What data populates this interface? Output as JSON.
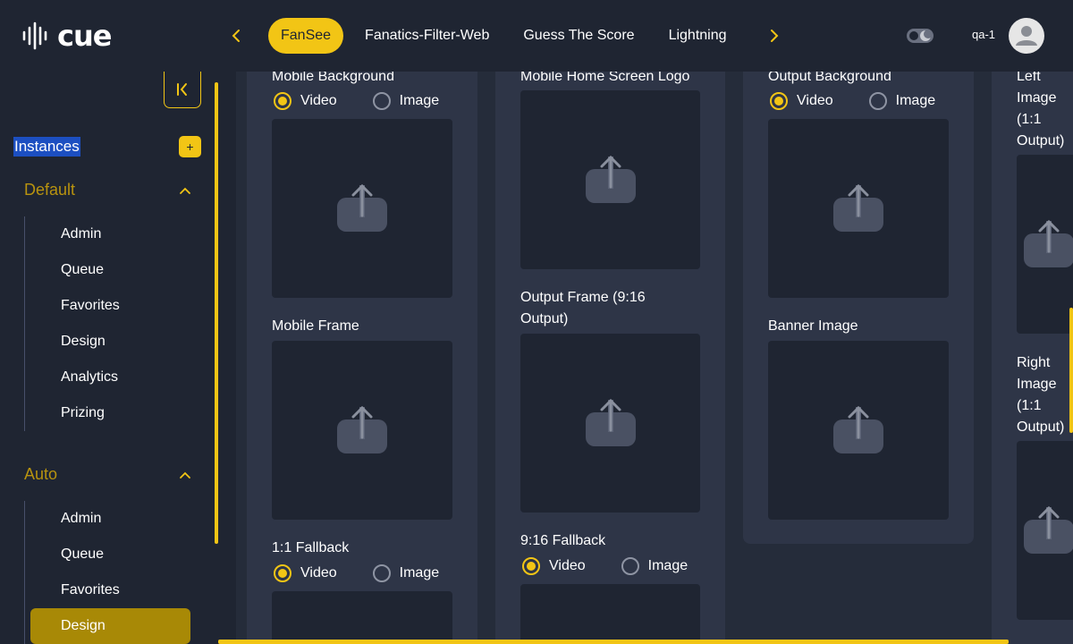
{
  "app": {
    "logo_text": "cue"
  },
  "header": {
    "tabs": [
      {
        "label": "FanSee",
        "active": true
      },
      {
        "label": "Fanatics-Filter-Web",
        "active": false
      },
      {
        "label": "Guess The Score",
        "active": false
      },
      {
        "label": "Lightning",
        "active": false
      }
    ],
    "user_name": "qa-1"
  },
  "sidebar": {
    "instances_label": "Instances",
    "add_label": "+",
    "groups": [
      {
        "name": "Default",
        "items": [
          "Admin",
          "Queue",
          "Favorites",
          "Design",
          "Analytics",
          "Prizing"
        ]
      },
      {
        "name": "Auto",
        "items": [
          "Admin",
          "Queue",
          "Favorites",
          "Design"
        ],
        "active_item": "Design"
      }
    ]
  },
  "main": {
    "columns": [
      {
        "fields": [
          {
            "label": "Mobile Background",
            "has_radio": true,
            "selected": "Video"
          },
          {
            "label": "Mobile Frame",
            "has_radio": false
          },
          {
            "label": "1:1 Fallback",
            "has_radio": true,
            "selected": "Video"
          }
        ]
      },
      {
        "fields": [
          {
            "label": "Mobile Home Screen Logo",
            "has_radio": false
          },
          {
            "label": "Output Frame (9:16 Output)",
            "has_radio": false
          },
          {
            "label": "9:16 Fallback",
            "has_radio": true,
            "selected": "Video"
          }
        ]
      },
      {
        "fields": [
          {
            "label": "Output Background",
            "has_radio": true,
            "selected": "Video"
          },
          {
            "label": "Banner Image",
            "has_radio": false
          }
        ]
      },
      {
        "fields": [
          {
            "label": "Left Image (1:1 Output)",
            "has_radio": false
          },
          {
            "label": "Right Image (1:1 Output)",
            "has_radio": false
          }
        ]
      }
    ],
    "radio_options": [
      "Video",
      "Image"
    ]
  },
  "colors": {
    "accent": "#f2c515",
    "background": "#1f2532",
    "card": "#2e3547",
    "active_item": "#a88906"
  }
}
